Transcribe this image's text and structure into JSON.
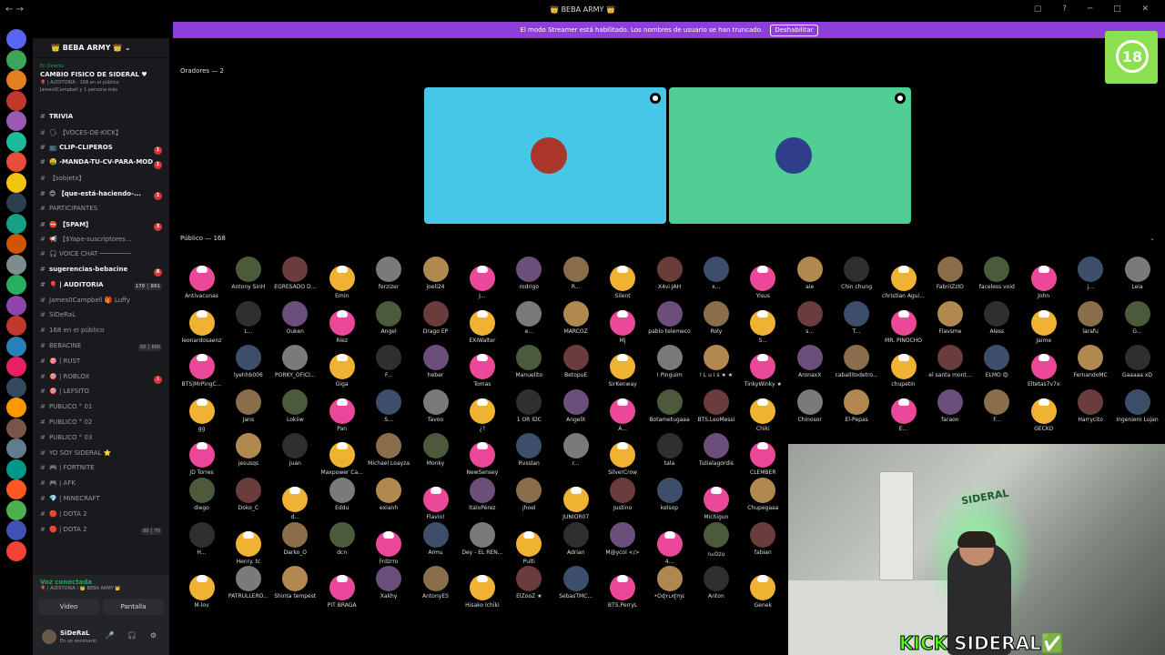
{
  "titlebar": {
    "title": "👑 BEBA ARMY 👑"
  },
  "banner": {
    "text": "El modo Streamer está habilitado. Los nombres de usuario se han truncado.",
    "button": "Deshabilitar"
  },
  "badge": {
    "text": "18"
  },
  "server": {
    "name": "👑 BEBA ARMY 👑",
    "live_tag": "En Directo",
    "live_title": "CAMBIO FISICO DE SIDERAL ♥",
    "live_sub1": "🎈 | AUDITORIA · 168 en el público",
    "live_sub2": "James0Campbell y 1 persona más"
  },
  "channels": [
    {
      "name": "TRIVIA",
      "bold": true,
      "unread": ""
    },
    {
      "name": "🗣 【VOCES-DE-KICK】",
      "bold": false,
      "unread": ""
    },
    {
      "name": "📺 CLIP-CLIPEROS",
      "bold": true,
      "unread": "1"
    },
    {
      "name": "🤑 -MANDA-TU-CV-PARA-MOD",
      "bold": true,
      "unread": "1"
    },
    {
      "name": "【sobjetx】",
      "bold": false,
      "unread": ""
    },
    {
      "name": "😊 【que-está-haciendo-...",
      "bold": true,
      "unread": "1"
    },
    {
      "name": "PARTICIPANTES",
      "bold": false,
      "unread": ""
    },
    {
      "name": "⛔ 【SPAM】",
      "bold": true,
      "unread": "3"
    },
    {
      "name": "📢 【$Yape-suscriptores...",
      "bold": false,
      "unread": ""
    },
    {
      "name": "🎧 VOICE CHAT ────────",
      "bold": false,
      "unread": ""
    },
    {
      "name": "sugerencias-bebacine",
      "bold": true,
      "unread": "8"
    },
    {
      "name": "🎈 | AUDITORIA",
      "bold": true,
      "unread": "",
      "count": "170 │ 891"
    },
    {
      "name": "James0Campbell 🎁 Luffy",
      "bold": false,
      "unread": ""
    },
    {
      "name": "SiDeRaL",
      "bold": false,
      "unread": ""
    },
    {
      "name": "168 en el público",
      "bold": false,
      "unread": ""
    },
    {
      "name": "BEBACINE",
      "bold": false,
      "unread": "",
      "count": "00 │ 690"
    },
    {
      "name": "🎯 | RUST",
      "bold": false,
      "unread": ""
    },
    {
      "name": "🎯 | ROBLOX",
      "bold": false,
      "unread": "1"
    },
    {
      "name": "🎯 | LEFSITO",
      "bold": false,
      "unread": ""
    },
    {
      "name": "PUBLICO ° 01",
      "bold": false,
      "unread": ""
    },
    {
      "name": "PUBLICO ° 02",
      "bold": false,
      "unread": ""
    },
    {
      "name": "PUBLICO ° 03",
      "bold": false,
      "unread": ""
    },
    {
      "name": "YO SOY SIDERAL ⭐",
      "bold": false,
      "unread": ""
    },
    {
      "name": "🎮 | FORTNITE",
      "bold": false,
      "unread": ""
    },
    {
      "name": "🎮 | AFK",
      "bold": false,
      "unread": ""
    },
    {
      "name": "💎 | MINECRAFT",
      "bold": false,
      "unread": ""
    },
    {
      "name": "🔴 | DOTA 2",
      "bold": false,
      "unread": ""
    },
    {
      "name": "🔴 | DOTA 2",
      "bold": false,
      "unread": "",
      "count": "00 │ 70"
    }
  ],
  "voicebar": {
    "status": "Voz conectada",
    "sub": "🎈 | AUDITORIA / 👑 BEBA ARMY 👑",
    "video": "Video",
    "screen": "Pantalla"
  },
  "user": {
    "name": "SiDeRaL",
    "status": "En un escenario"
  },
  "stage": {
    "speakers_header": "Oradores — 2",
    "public_header": "Público — 168"
  },
  "speakers": [
    {
      "color": "#46c7e8",
      "avatar": "#a8362c"
    },
    {
      "color": "#4fcf94",
      "avatar": "#2e3e8a"
    }
  ],
  "audience": [
    "Antivacunas",
    "Antony SinH",
    "EGRESADO D...",
    "Emin",
    "ferzizer",
    "joeli24",
    "J...",
    "rodrigo",
    "R...",
    "Silent",
    "X4vi.JAH",
    "x...",
    "Yisus",
    "aie",
    "Chin chung",
    "christian Agui...",
    "FabriIZzIO",
    "faceless void",
    "John",
    "j...",
    "Leia",
    "leonardosaenz",
    "L...",
    "Ouken",
    "Riez",
    "Angel",
    "Drago EP",
    "EXIWalter",
    "e...",
    "MARCOZ",
    "Mj",
    "pablo telemeco",
    "Roly",
    "S...",
    "s...",
    "T...",
    "MR. PINOCHO",
    "Flavsme",
    "Aless",
    "Jaime",
    "larafu",
    "G...",
    "BTS|MrPingC...",
    "lyehhb006",
    "PORKY_OFICI...",
    "Giga",
    "F...",
    "heber",
    "Tomas",
    "Manuelito",
    "BetopuE",
    "SirKenway",
    "! Pinguim",
    "! L u i s ★ ★",
    "TinkyWinky ★",
    "AronaxX",
    "caballitodetro...",
    "chupetin",
    "el santa mont...",
    "ELMO 😍",
    "Eltetas7v7x",
    "FernandoMC",
    "Gaaaaa xD",
    "gg",
    "Jans",
    "Lokiiw",
    "Pan",
    "S...",
    "Tavoo",
    "¿?",
    "1 OR IDC",
    "AngelX",
    "A...",
    "Botametugaaa",
    "BTS.LeoMessi",
    "Chiki",
    "Chinosor",
    "El-Pepas",
    "E...",
    "faraon",
    "F...",
    "GECKO",
    "Harrycito",
    "Ingeniero Lujan",
    "JD Torres",
    "jesusqs",
    "Juan",
    "Maxpower Ca...",
    "Michael Loayza",
    "Monky",
    "NewSensey",
    "Rvsslan",
    "r...",
    "SilverCrow",
    "tala",
    "Tutialagordis",
    "CLEMBER",
    "diego",
    "Doko_C",
    "d...",
    "Eddu",
    "exianh",
    "Flavio!",
    "ItaloPérez",
    "jhoel",
    "JUNIOR07",
    "Justino",
    "kelsop",
    "Michigun",
    "Chupegaaa",
    "H...",
    "Henry. tc",
    "Darko_O",
    "dcn",
    "Frdzrro",
    "Armu",
    "Dey - EL REN...",
    "Pulti",
    "Adrian",
    "M@ycol </>",
    "4...",
    "ก๐Ozu",
    "fabian",
    "M-lov",
    "PATRULLERO...",
    "Shinta tempest",
    "PIT BRAGA",
    "Xakhy",
    "AntonyES",
    "Hisako Ichiki",
    "ElZooZ ★",
    "SebasTMC...",
    "BTS.PerryL",
    "•Oɖʏʟʌʈɱɛ",
    "Anton",
    "Genek"
  ],
  "webcam": {
    "brand": "SIDERAL",
    "kick": "KICK",
    "name": "SIDERAL✅"
  }
}
